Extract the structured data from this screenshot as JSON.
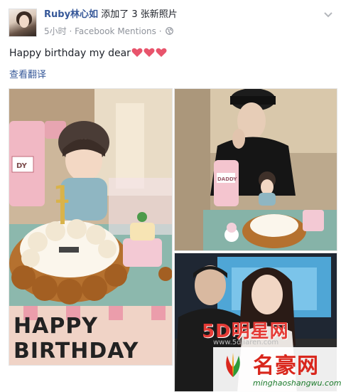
{
  "post": {
    "author": "Ruby林心如",
    "action": "添加了 3 张新照片",
    "time": "5小时",
    "source": "Facebook Mentions",
    "separator": "·",
    "message": "Happy birthday my dear",
    "translate_label": "查看翻译",
    "heart_count": 3,
    "heart_color": "#e8546c",
    "link_color": "#365899",
    "privacy_icon": "globe-icon",
    "menu_icon": "chevron-down-icon"
  },
  "photos": [
    {
      "scene": "birthday-cake-closeup",
      "cake_label": "HAPPY BIRTHDAY",
      "board_label": "DY",
      "candle_number": "1"
    },
    {
      "scene": "man-in-cap-with-cake",
      "board_label": "DADDY"
    },
    {
      "scene": "couple-selfie"
    }
  ],
  "watermarks": {
    "site1": "5D明星网",
    "site1_url": "www.5djiaren.com",
    "site2": "名豪网",
    "site2_url": "minghaoshangwu.com"
  }
}
